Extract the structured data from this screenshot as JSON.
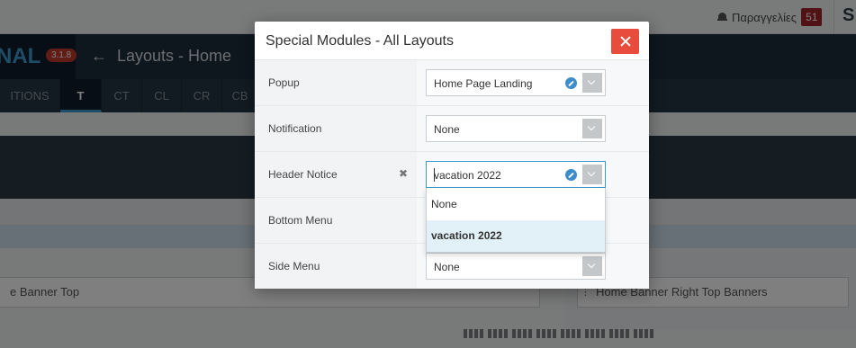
{
  "app": {
    "brand_text": "NAL",
    "version_badge": "3.1.8",
    "page_title": "Layouts - Home",
    "notifications": {
      "label": "Παραγγελίες",
      "count": "51"
    },
    "topbar_letter": "S",
    "tabs": [
      {
        "label": "ITIONS",
        "active": false
      },
      {
        "label": "T",
        "active": true
      },
      {
        "label": "CT",
        "active": false
      },
      {
        "label": "CL",
        "active": false
      },
      {
        "label": "CR",
        "active": false
      },
      {
        "label": "CB",
        "active": false
      }
    ],
    "slots": {
      "left": "e Banner Top",
      "right": "Home Banner Right Top Banners"
    }
  },
  "modal": {
    "title": "Special Modules - All Layouts",
    "rows": [
      {
        "label": "Popup",
        "value": "Home Page Landing",
        "has_edit": true
      },
      {
        "label": "Notification",
        "value": "None",
        "has_edit": false
      },
      {
        "label": "Header Notice",
        "value": "vacation 2022",
        "has_edit": true,
        "open": true
      },
      {
        "label": "Bottom Menu",
        "value": "",
        "has_edit": false
      },
      {
        "label": "Side Menu",
        "value": "None",
        "has_edit": false
      }
    ],
    "dropdown_options": [
      {
        "label": "None",
        "selected": false
      },
      {
        "label": "vacation 2022",
        "selected": true
      }
    ]
  },
  "colors": {
    "accent": "#3d9ad1",
    "close": "#e74c3c",
    "badge": "#a0242b",
    "header_bg": "#1d2d3c"
  }
}
